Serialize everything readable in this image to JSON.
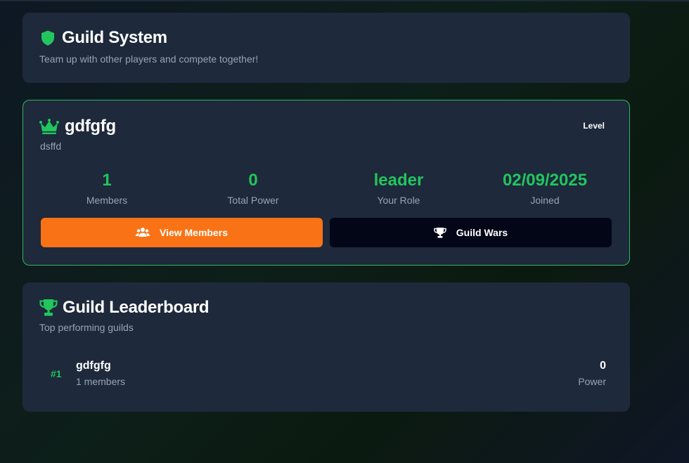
{
  "header": {
    "title": "Guild System",
    "subtitle": "Team up with other players and compete together!"
  },
  "guild": {
    "name": "gdfgfg",
    "description": "dsffd",
    "level_label": "Level",
    "stats": [
      {
        "value": "1",
        "label": "Members"
      },
      {
        "value": "0",
        "label": "Total Power"
      },
      {
        "value": "leader",
        "label": "Your Role"
      },
      {
        "value": "02/09/2025",
        "label": "Joined"
      }
    ],
    "view_members_label": "View Members",
    "guild_wars_label": "Guild Wars"
  },
  "leaderboard": {
    "title": "Guild Leaderboard",
    "subtitle": "Top performing guilds",
    "rows": [
      {
        "rank": "#1",
        "name": "gdfgfg",
        "members": "1 members",
        "power": "0",
        "power_label": "Power"
      }
    ]
  },
  "colors": {
    "accent_green": "#22c55e",
    "accent_orange": "#f97316",
    "card_bg": "#1e293b"
  }
}
